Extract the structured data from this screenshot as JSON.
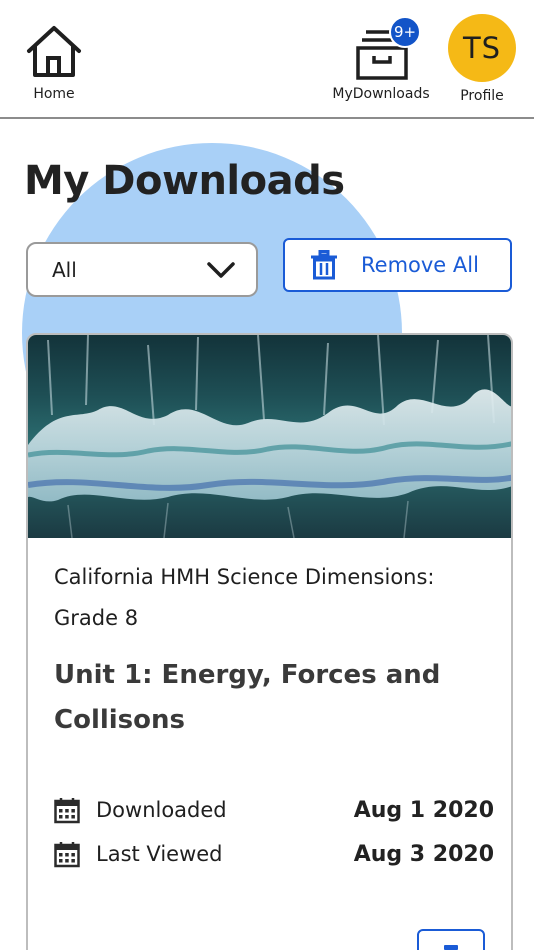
{
  "nav": {
    "home_label": "Home",
    "downloads_label": "MyDownloads",
    "downloads_badge": "9+",
    "profile_label": "Profile",
    "profile_initials": "TS"
  },
  "page": {
    "title": "My Downloads"
  },
  "filter": {
    "selected": "All"
  },
  "actions": {
    "remove_all_label": "Remove All"
  },
  "downloads": [
    {
      "series": "California HMH Science Dimensions: Grade 8",
      "unit": "Unit 1: Energy, Forces and Collisons",
      "downloaded_label": "Downloaded",
      "downloaded_date": "Aug 1 2020",
      "last_viewed_label": "Last Viewed",
      "last_viewed_date": "Aug 3 2020"
    }
  ],
  "colors": {
    "accent": "#1a5bd6",
    "badge": "#1254c8",
    "avatar": "#f5b916",
    "decor_circle": "#a9d0f7"
  },
  "icons": {
    "home": "home-icon",
    "downloads": "archive-box-icon",
    "trash": "trash-icon",
    "chevron": "chevron-down-icon",
    "calendar": "calendar-icon"
  }
}
